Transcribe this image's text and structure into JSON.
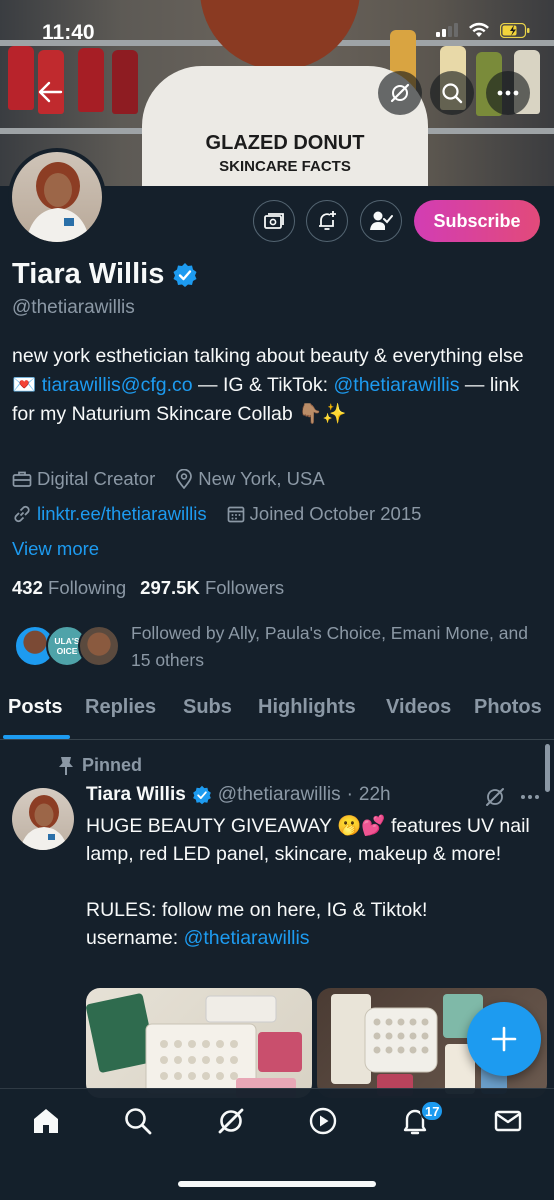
{
  "status_bar": {
    "time": "11:40"
  },
  "banner": {
    "shirt_line1": "GLAZED DONUT",
    "shirt_line2": "SKINCARE FACTS"
  },
  "profile": {
    "name": "Tiara Willis",
    "handle": "@thetiarawillis",
    "subscribe_label": "Subscribe",
    "bio": {
      "part1": "new york esthetician talking about beauty & everything else ",
      "emoji1": "💌",
      "email": "tiarawillis@cfg.co",
      "part2": " — IG & TikTok: ",
      "mention": "@thetiarawillis",
      "part3": " — link for my Naturium Skincare Collab ",
      "emoji2": "👇🏽✨"
    },
    "category": "Digital Creator",
    "location": "New York, USA",
    "website": "linktr.ee/thetiarawillis",
    "joined": "Joined October 2015",
    "view_more": "View more",
    "following_count": "432",
    "following_label": "Following",
    "followers_count": "297.5K",
    "followers_label": "Followers",
    "followed_by": "Followed by Ally, Paula's Choice, Emani Mone, and 15 others",
    "follower_avatar_text": "ULA'S OICE"
  },
  "tabs": [
    "Posts",
    "Replies",
    "Subs",
    "Highlights",
    "Videos",
    "Photos"
  ],
  "active_tab": "Posts",
  "pinned_tweet": {
    "pinned_label": "Pinned",
    "author_name": "Tiara Willis",
    "author_handle": "@thetiarawillis",
    "separator": "·",
    "time": "22h",
    "line1": "HUGE BEAUTY GIVEAWAY 🫢💕 features UV nail lamp, red LED panel, skincare, makeup & more!",
    "line2": "RULES: follow me on here, IG & Tiktok!",
    "line3_prefix": "username: ",
    "line3_mention": "@thetiarawillis"
  },
  "bottom_nav": {
    "notification_count": "17"
  },
  "colors": {
    "background": "#15202b",
    "accent": "#1d9bf0",
    "muted": "#8b98a5",
    "subscribe_start": "#d23db4",
    "subscribe_end": "#e24a7a"
  }
}
